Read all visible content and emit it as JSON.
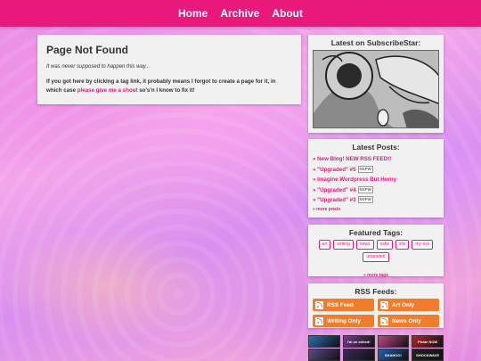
{
  "nav": {
    "items": [
      {
        "label": "Home"
      },
      {
        "label": "Archive"
      },
      {
        "label": "About"
      }
    ]
  },
  "main": {
    "title": "Page Not Found",
    "lead": "It was never supposed to happen this way...",
    "body_prefix": "If you got here by clicking a tag link, it probably means I forgot to create a page for it, in which case ",
    "body_link": "please give me a shout",
    "body_suffix": " so's'n I know to fix it!"
  },
  "sidebar": {
    "subscribestar": {
      "heading": "Latest on SubscribeStar:"
    },
    "posts": {
      "heading": "Latest Posts:",
      "items": [
        {
          "label": "» New Blog! NEW RSS FEED!!",
          "nsfw": ""
        },
        {
          "label": "» \"Upgraded\" #5",
          "nsfw": "NSFW"
        },
        {
          "label": "» Imagine Wordpress But Horny",
          "nsfw": ""
        },
        {
          "label": "» \"Upgraded\" #4",
          "nsfw": "NSFW"
        },
        {
          "label": "» \"Upgraded\" #3",
          "nsfw": "NSFW"
        }
      ],
      "more": "» more posts"
    },
    "tags": {
      "heading": "Featured Tags:",
      "items": [
        "art",
        "writing",
        "news",
        "nsfw",
        "sfw",
        "my-ocs",
        "upgraded"
      ],
      "more": "» more tags"
    },
    "rss": {
      "heading": "RSS Feeds:",
      "buttons": [
        "RSS Feed",
        "Art Only",
        "Writing Only",
        "News Only"
      ]
    },
    "web_buttons": [
      {
        "text": "",
        "color": "#2a6fb3"
      },
      {
        "text": "i'm on mfeed!",
        "color": "#7a3b8f"
      },
      {
        "text": "",
        "color": "#c0478a"
      },
      {
        "text": "Pirate NOW",
        "color": "#b32424"
      },
      {
        "text": "",
        "color": "#5b4a8a"
      },
      {
        "text": "",
        "color": "#3a2a5a"
      },
      {
        "text": "SKAHOO!",
        "color": "#2060b0"
      },
      {
        "text": "SHOCKWAVE",
        "color": "#222222"
      }
    ]
  },
  "colors": {
    "accent": "#e8197a",
    "rss": "#f07d2b",
    "panel": "#f1f1f1"
  }
}
